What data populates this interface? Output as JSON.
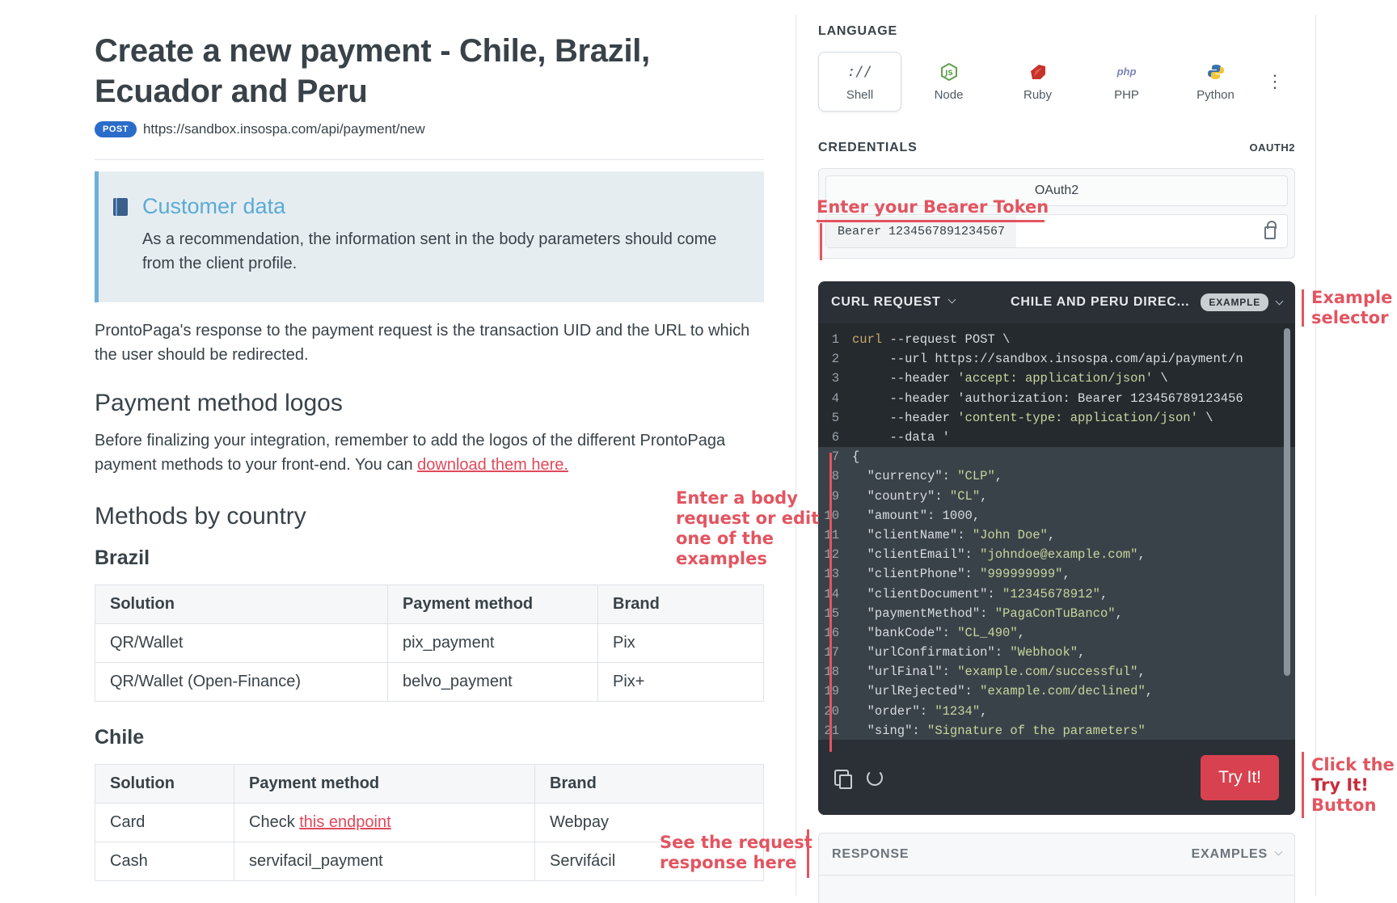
{
  "main": {
    "title": "Create a new payment - Chile, Brazil, Ecuador and Peru",
    "method": "POST",
    "url": "https://sandbox.insospa.com/api/payment/new",
    "callout_title": "Customer data",
    "callout_text": "As a recommendation, the information sent in the body parameters should come from the client profile.",
    "response_para": "ProntoPaga's response to the payment request is the transaction UID and the URL to which the user should be redirected.",
    "logos_heading": "Payment method logos",
    "logos_para": "Before finalizing your integration, remember to add the logos of the different ProntoPaga payment methods to your front-end. You can ",
    "logos_link": "download them here.",
    "methods_heading": "Methods by country",
    "brazil_heading": "Brazil",
    "chile_heading": "Chile",
    "table_headers": [
      "Solution",
      "Payment method",
      "Brand"
    ],
    "brazil_rows": [
      [
        "QR/Wallet",
        "pix_payment",
        "Pix"
      ],
      [
        "QR/Wallet (Open-Finance)",
        "belvo_payment",
        "Pix+"
      ]
    ],
    "chile_rows": [
      [
        "Card",
        "Check ",
        "this endpoint",
        "Webpay"
      ],
      [
        "Cash",
        "servifacil_payment",
        "",
        "Servifácil"
      ]
    ]
  },
  "panel": {
    "language_label": "LANGUAGE",
    "languages": [
      "Shell",
      "Node",
      "Ruby",
      "PHP",
      "Python"
    ],
    "credentials_label": "CREDENTIALS",
    "oauth_tag": "OAUTH2",
    "oauth_tab": "OAuth2",
    "bearer_prefix": "Bearer",
    "bearer_token": "1234567891234567",
    "request_label": "CURL REQUEST",
    "example_name": "CHILE AND PERU DIREC...",
    "example_badge": "EXAMPLE",
    "try_button": "Try It!",
    "response_label": "RESPONSE",
    "examples_label": "EXAMPLES"
  },
  "code_lines": [
    "curl --request POST \\",
    "     --url https://sandbox.insospa.com/api/payment/n",
    "     --header 'accept: application/json' \\",
    "     --header 'authorization: Bearer 123456789123456",
    "     --header 'content-type: application/json' \\",
    "     --data '",
    "{",
    "  \"currency\": \"CLP\",",
    "  \"country\": \"CL\",",
    "  \"amount\": 1000,",
    "  \"clientName\": \"John Doe\",",
    "  \"clientEmail\": \"johndoe@example.com\",",
    "  \"clientPhone\": \"999999999\",",
    "  \"clientDocument\": \"12345678912\",",
    "  \"paymentMethod\": \"PagaConTuBanco\",",
    "  \"bankCode\": \"CL_490\",",
    "  \"urlConfirmation\": \"Webhook\",",
    "  \"urlFinal\": \"example.com/successful\",",
    "  \"urlRejected\": \"example.com/declined\",",
    "  \"order\": \"1234\",",
    "  \"sing\": \"Signature of the parameters\""
  ],
  "annotations": {
    "bearer": "Enter your Bearer Token",
    "example_selector_1": "Example",
    "example_selector_2": "selector",
    "body_1": "Enter a body",
    "body_2": "request or edit",
    "body_3": "one of the",
    "body_4": "examples",
    "try_1": "Click the",
    "try_2": "Try It!",
    "try_3": "Button",
    "response_1": "See the request",
    "response_2": "response here"
  },
  "colors": {
    "accent_red": "#e25560",
    "post_badge": "#2a6cc9",
    "callout_border": "#6fb0d6",
    "code_bg": "#252a2f",
    "try_button": "#d8414f"
  }
}
